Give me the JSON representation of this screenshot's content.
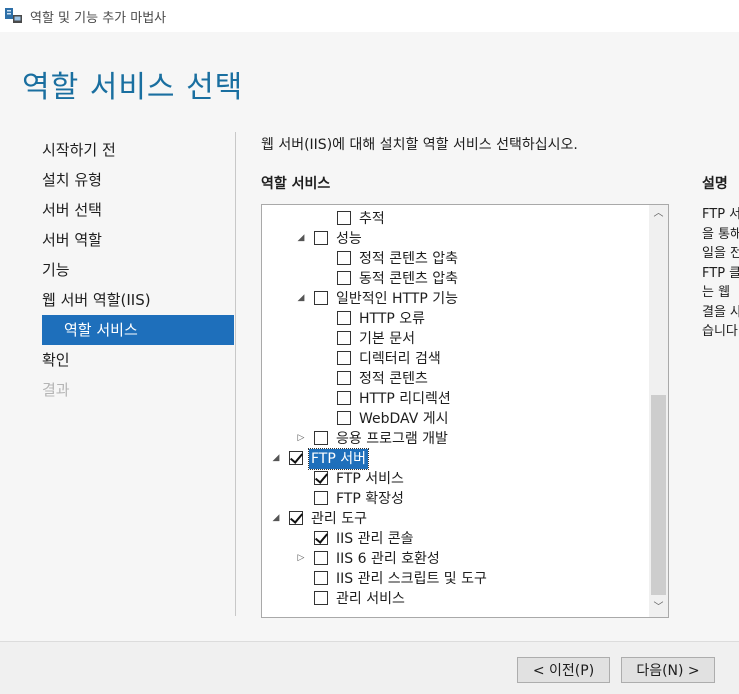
{
  "window": {
    "title": "역할 및 기능 추가 마법사"
  },
  "page_title": "역할 서비스 선택",
  "steps": [
    {
      "label": "시작하기 전",
      "state": "normal"
    },
    {
      "label": "설치 유형",
      "state": "normal"
    },
    {
      "label": "서버 선택",
      "state": "normal"
    },
    {
      "label": "서버 역할",
      "state": "normal"
    },
    {
      "label": "기능",
      "state": "normal"
    },
    {
      "label": "웹 서버 역할(IIS)",
      "state": "normal"
    },
    {
      "label": "역할 서비스",
      "state": "active"
    },
    {
      "label": "확인",
      "state": "normal"
    },
    {
      "label": "결과",
      "state": "disabled"
    }
  ],
  "instruction": "웹 서버(IIS)에 대해 설치할 역할 서비스 선택하십시오.",
  "role_services_heading": "역할 서비스",
  "description": {
    "heading": "설명",
    "lines": [
      "FTP 서",
      "을 통해",
      "일을 전",
      "FTP 클",
      "는 웹 ",
      "결을 사",
      "습니다"
    ]
  },
  "tree": [
    {
      "label": "추적",
      "level": 3,
      "checked": false,
      "expander": "none"
    },
    {
      "label": "성능",
      "level": 2,
      "checked": false,
      "expander": "expanded"
    },
    {
      "label": "정적 콘텐츠 압축",
      "level": 3,
      "checked": false,
      "expander": "none"
    },
    {
      "label": "동적 콘텐츠 압축",
      "level": 3,
      "checked": false,
      "expander": "none"
    },
    {
      "label": "일반적인 HTTP 기능",
      "level": 2,
      "checked": false,
      "expander": "expanded"
    },
    {
      "label": "HTTP 오류",
      "level": 3,
      "checked": false,
      "expander": "none"
    },
    {
      "label": "기본 문서",
      "level": 3,
      "checked": false,
      "expander": "none"
    },
    {
      "label": "디렉터리 검색",
      "level": 3,
      "checked": false,
      "expander": "none"
    },
    {
      "label": "정적 콘텐츠",
      "level": 3,
      "checked": false,
      "expander": "none"
    },
    {
      "label": "HTTP 리디렉션",
      "level": 3,
      "checked": false,
      "expander": "none"
    },
    {
      "label": "WebDAV 게시",
      "level": 3,
      "checked": false,
      "expander": "none"
    },
    {
      "label": "응용 프로그램 개발",
      "level": 2,
      "checked": false,
      "expander": "collapsed"
    },
    {
      "label": "FTP 서버",
      "level": 1,
      "checked": true,
      "expander": "expanded",
      "selected": true
    },
    {
      "label": "FTP 서비스",
      "level": 2,
      "checked": true,
      "expander": "none"
    },
    {
      "label": "FTP 확장성",
      "level": 2,
      "checked": false,
      "expander": "none"
    },
    {
      "label": "관리 도구",
      "level": 1,
      "checked": true,
      "expander": "expanded"
    },
    {
      "label": "IIS 관리 콘솔",
      "level": 2,
      "checked": true,
      "expander": "none"
    },
    {
      "label": "IIS 6 관리 호환성",
      "level": 2,
      "checked": false,
      "expander": "collapsed"
    },
    {
      "label": "IIS 관리 스크립트 및 도구",
      "level": 2,
      "checked": false,
      "expander": "none"
    },
    {
      "label": "관리 서비스",
      "level": 2,
      "checked": false,
      "expander": "none"
    }
  ],
  "buttons": {
    "prev": "< 이전(P)",
    "next": "다음(N) >"
  },
  "colors": {
    "accent": "#1e6fbb",
    "title": "#1a6fa0"
  }
}
